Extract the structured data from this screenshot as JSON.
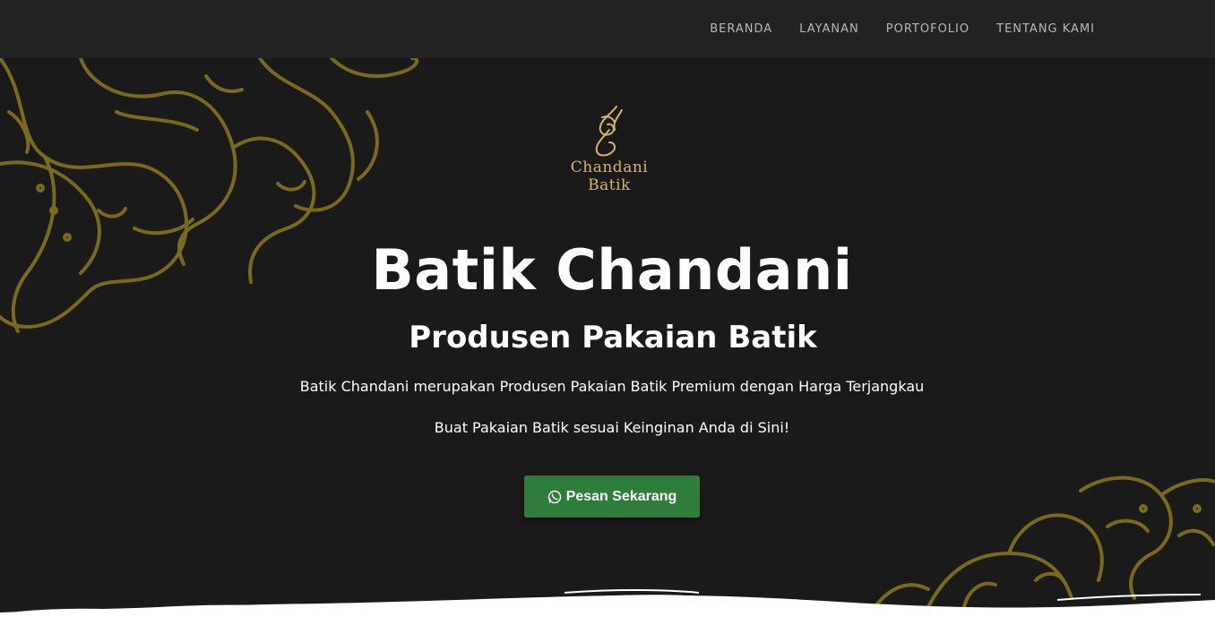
{
  "nav": {
    "items": [
      {
        "label": "BERANDA"
      },
      {
        "label": "LAYANAN"
      },
      {
        "label": "PORTOFOLIO"
      },
      {
        "label": "TENTANG KAMI"
      }
    ]
  },
  "logo": {
    "line1": "Chandani",
    "line2": "Batik"
  },
  "hero": {
    "title": "Batik Chandani",
    "subtitle": "Produsen Pakaian Batik",
    "description1": "Batik Chandani merupakan Produsen Pakaian Batik Premium dengan Harga Terjangkau",
    "description2": "Buat Pakaian Batik sesuai Keinginan Anda di Sini!",
    "cta_label": "Pesan Sekarang",
    "cta_icon": "whatsapp-icon"
  },
  "colors": {
    "navbar_bg": "#222222",
    "hero_bg": "#1a1a1a",
    "floral_gold": "#7a6a1c",
    "logo_gold": "#d8b46a",
    "cta_green": "#2e7d3a"
  }
}
